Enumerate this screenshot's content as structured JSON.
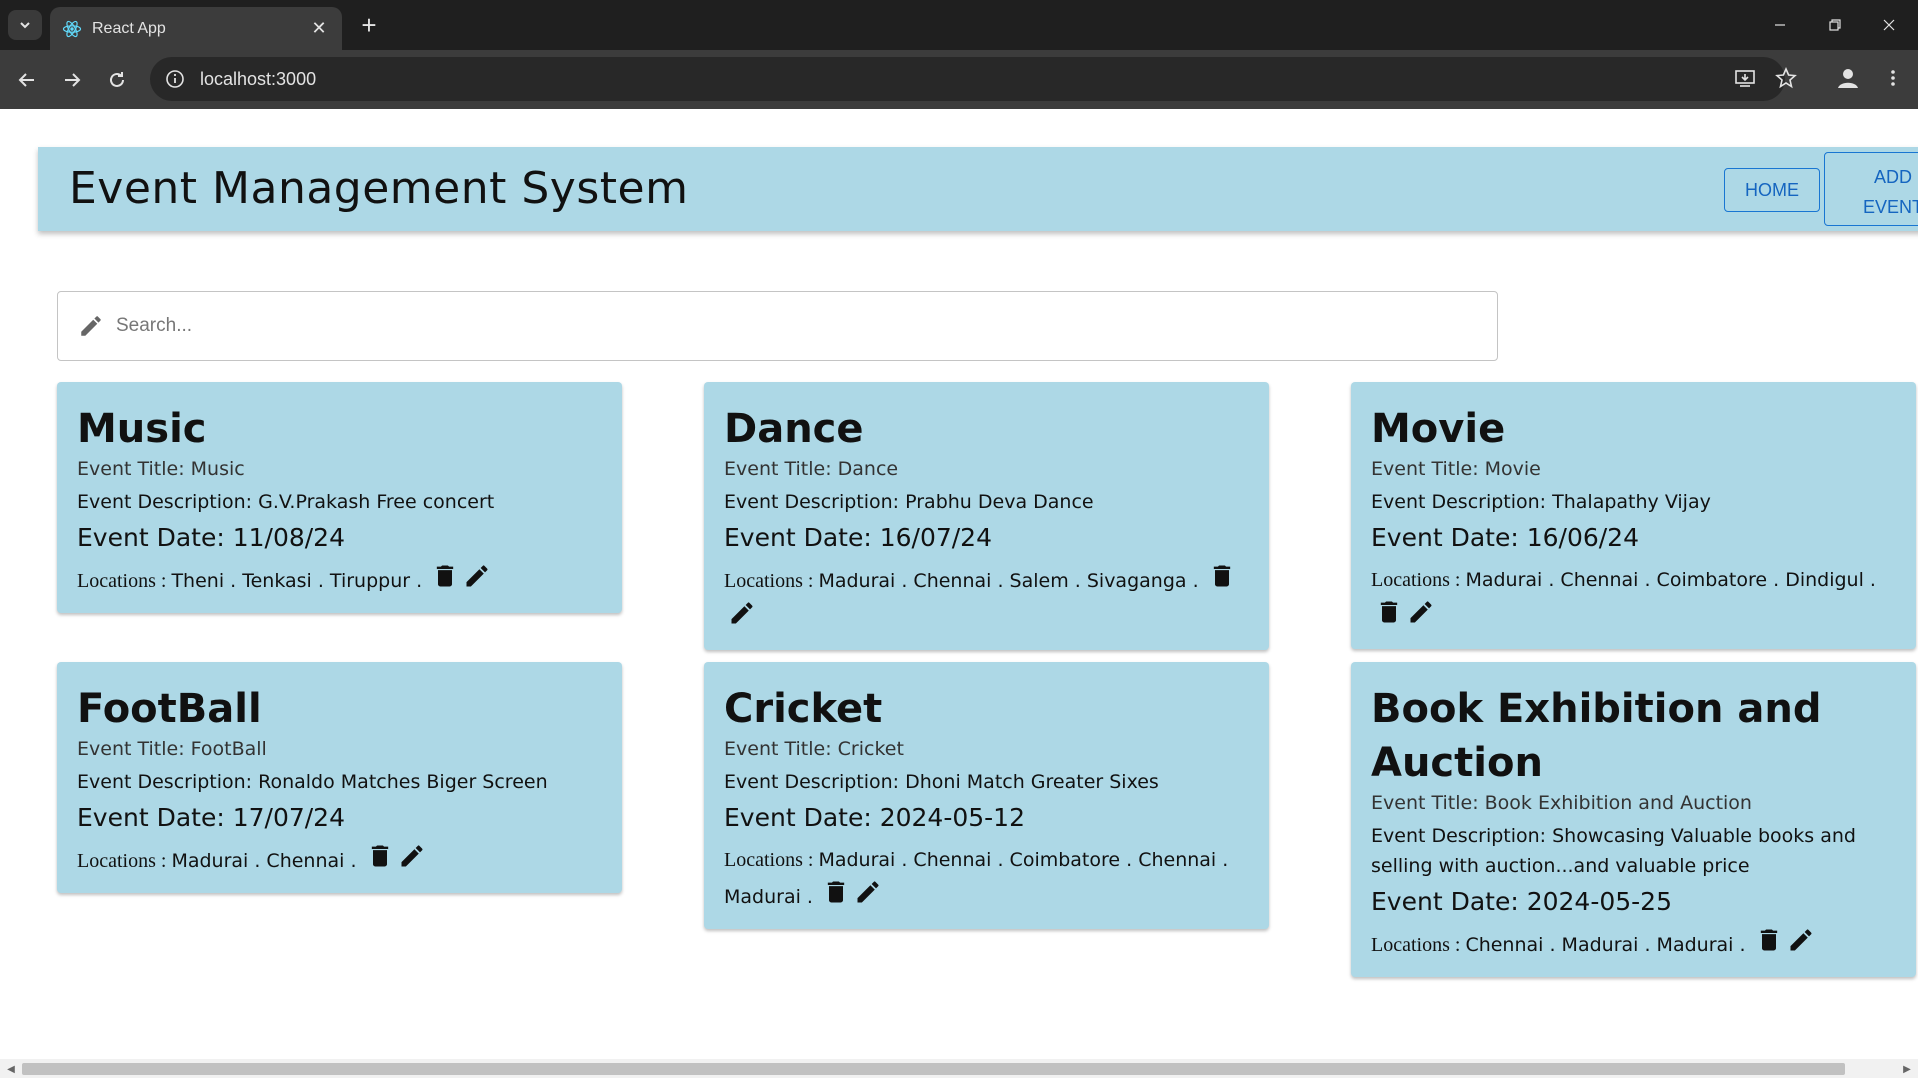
{
  "browser": {
    "tab_title": "React App",
    "url": "localhost:3000"
  },
  "app": {
    "title": "Event Management System",
    "nav": {
      "home": "HOME",
      "add_event_line1": "ADD",
      "add_event_line2": "EVENT"
    },
    "search_placeholder": "Search...",
    "labels": {
      "title_prefix": "Event Title: ",
      "desc_prefix": "Event Description: ",
      "date_prefix": "Event Date: ",
      "loc_prefix": "Locations : "
    },
    "events": [
      {
        "heading": "Music",
        "title": "Music",
        "description": "G.V.Prakash Free concert",
        "date": "11/08/24",
        "locations": "Theni . Tenkasi . Tiruppur ."
      },
      {
        "heading": "Dance",
        "title": "Dance",
        "description": "Prabhu Deva Dance",
        "date": "16/07/24",
        "locations": "Madurai . Chennai . Salem  . Sivaganga ."
      },
      {
        "heading": "Movie",
        "title": "Movie",
        "description": "Thalapathy Vijay",
        "date": "16/06/24",
        "locations": "Madurai . Chennai . Coimbatore . Dindigul ."
      },
      {
        "heading": "FootBall",
        "title": "FootBall",
        "description": "Ronaldo Matches Biger Screen",
        "date": "17/07/24",
        "locations": "Madurai . Chennai ."
      },
      {
        "heading": "Cricket",
        "title": "Cricket",
        "description": "Dhoni Match Greater Sixes",
        "date": "2024-05-12",
        "locations": "Madurai . Chennai . Coimbatore . Chennai . Madurai ."
      },
      {
        "heading": "Book Exhibition and Auction",
        "title": "Book Exhibition and Auction",
        "description": "Showcasing Valuable books and selling with auction...and valuable price",
        "date": "2024-05-25",
        "locations": "Chennai . Madurai . Madurai ."
      }
    ]
  },
  "colors": {
    "appbar": "#add8e6",
    "card": "#add8e6",
    "button_outline": "#1976d2"
  },
  "icons": {
    "delete": "trash-icon",
    "edit": "pencil-icon",
    "search": "pencil-icon"
  }
}
